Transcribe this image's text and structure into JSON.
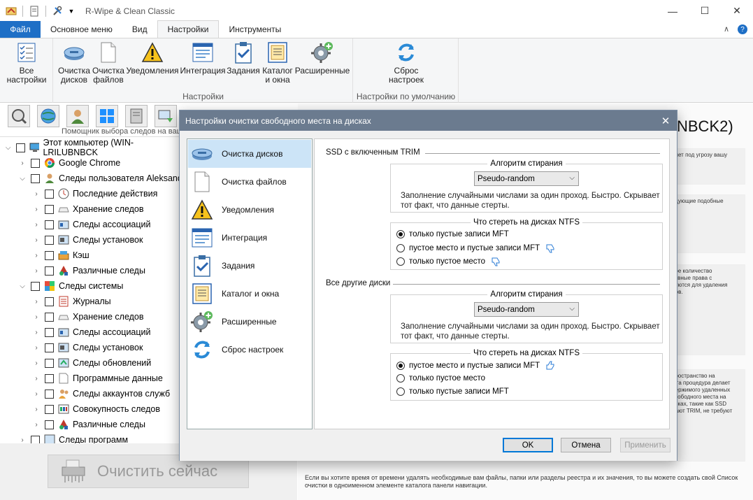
{
  "app": {
    "title": "R-Wipe & Clean Classic"
  },
  "window_controls": {
    "minimize": "—",
    "maximize": "☐",
    "close": "✕"
  },
  "ribbon": {
    "tabs": [
      "Файл",
      "Основное меню",
      "Вид",
      "Настройки",
      "Инструменты"
    ],
    "active_tab": "Настройки",
    "groups": [
      {
        "label": "Настройки",
        "buttons": [
          "Все\nнастройки",
          "Очистка\nдисков",
          "Очистка\nфайлов",
          "Уведомления",
          "Интеграция",
          "Задания",
          "Каталог\nи окна",
          "Расширенные"
        ]
      },
      {
        "label": "Настройки по умолчанию",
        "buttons": [
          "Сброс\nнастроек"
        ]
      }
    ],
    "btn_all": "Все",
    "btn_all2": "настройки",
    "btn_disks": "Очистка",
    "btn_disks2": "дисков",
    "btn_files": "Очистка",
    "btn_files2": "файлов",
    "btn_notify": "Уведомления",
    "btn_integr": "Интеграция",
    "btn_tasks": "Задания",
    "btn_catalog": "Каталог",
    "btn_catalog2": "и окна",
    "btn_adv": "Расширенные",
    "btn_reset": "Сброс",
    "btn_reset2": "настроек",
    "group1_label": "Настройки",
    "group2_label": "Настройки по умолчанию"
  },
  "left_toolbar": {
    "caption": "Помощник выбора следов на ваш"
  },
  "tree": {
    "root": "Этот компьютер  (WIN-LRILUBNBCK",
    "items": [
      {
        "label": "Google Chrome"
      },
      {
        "label": "Следы пользователя Aleksandr"
      },
      {
        "label": "Последние действия"
      },
      {
        "label": "Хранение следов"
      },
      {
        "label": "Следы ассоциаций"
      },
      {
        "label": "Следы установок"
      },
      {
        "label": "Кэш"
      },
      {
        "label": "Различные следы"
      },
      {
        "label": "Следы системы"
      },
      {
        "label": "Журналы"
      },
      {
        "label": "Хранение следов"
      },
      {
        "label": "Следы ассоциаций"
      },
      {
        "label": "Следы установок"
      },
      {
        "label": "Следы обновлений"
      },
      {
        "label": "Программные данные"
      },
      {
        "label": "Следы аккаунтов служб"
      },
      {
        "label": "Совокупность следов"
      },
      {
        "label": "Различные следы"
      },
      {
        "label": "Следы программ"
      }
    ]
  },
  "clean_button": {
    "label": "Очистить сейчас"
  },
  "right_panel": {
    "heading": "NBCK2)",
    "card1": "ляет под угрозу вашу",
    "card2": "едующие подобные",
    "card3": "ное количество\nтивные права с\nбуются для удаления\nдов.",
    "card4": "пространство на\nЭта процедура делает\nдержимого удаленных\nсвободного места на\nисках, такие как SSD\nдают TRIM, не требуют",
    "footer": "Если вы хотите время от времени удалять необходимые вам файлы, папки или разделы реестра и их значения, то вы можете создать свой Список очистки в одноименном элементе каталога панели навигации."
  },
  "dialog": {
    "title": "Настройки очистки свободного места на дисках",
    "nav": [
      "Очистка дисков",
      "Очистка файлов",
      "Уведомления",
      "Интеграция",
      "Задания",
      "Каталог и окна",
      "Расширенные",
      "Сброс настроек"
    ],
    "ssd": {
      "section_title": "SSD с включенным TRIM",
      "algo_legend": "Алгоритм стирания",
      "algo_value": "Pseudo-random",
      "algo_desc1": "Заполнение случайными числами за один проход. Быстро. Скрывает",
      "algo_desc2": "тот факт, что данные стерты.",
      "ntfs_legend": "Что стереть на дисках NTFS",
      "options": [
        "только пустые записи MFT",
        "пустое место и пустые записи MFT",
        "только пустое место"
      ],
      "selected": 0
    },
    "other": {
      "section_title": "Все другие диски",
      "algo_legend": "Алгоритм стирания",
      "algo_value": "Pseudo-random",
      "algo_desc1": "Заполнение случайными числами за один проход. Быстро. Скрывает",
      "algo_desc2": "тот факт, что данные стерты.",
      "ntfs_legend": "Что стереть на дисках NTFS",
      "options": [
        "пустое место и пустые записи MFT",
        "только пустое место",
        "только пустые записи MFT"
      ],
      "selected": 0
    },
    "buttons": {
      "ok": "OK",
      "cancel": "Отмена",
      "apply": "Применить"
    }
  },
  "colors": {
    "accent": "#1e6fc6",
    "dialog_title": "#6b7b8f",
    "nav_selected": "#cce4f7"
  }
}
